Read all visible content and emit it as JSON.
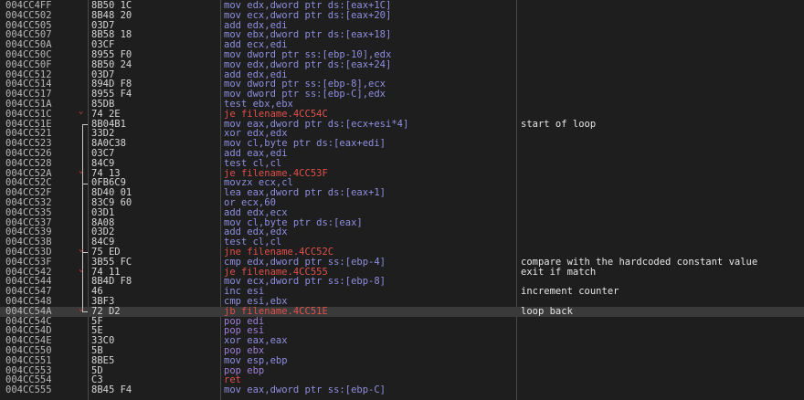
{
  "colors": {
    "background": "#1e1e1e",
    "address": "#b8b8b8",
    "bytes": "#d6d6d6",
    "instruction": "#8f8fe0",
    "jump_instruction": "#e0504a",
    "comment": "#e6e6e6",
    "selected_row": "#3a3a3a"
  },
  "rows": [
    {
      "addr": "004CC4FF",
      "bytes": "8B50 1C",
      "instr": "mov edx,dword ptr ds:[eax+1C]",
      "kind": "mov",
      "comment": ""
    },
    {
      "addr": "004CC502",
      "bytes": "8B48 20",
      "instr": "mov ecx,dword ptr ds:[eax+20]",
      "kind": "mov",
      "comment": ""
    },
    {
      "addr": "004CC505",
      "bytes": "03D7",
      "instr": "add edx,edi",
      "kind": "mov",
      "comment": ""
    },
    {
      "addr": "004CC507",
      "bytes": "8B58 18",
      "instr": "mov ebx,dword ptr ds:[eax+18]",
      "kind": "mov",
      "comment": ""
    },
    {
      "addr": "004CC50A",
      "bytes": "03CF",
      "instr": "add ecx,edi",
      "kind": "mov",
      "comment": ""
    },
    {
      "addr": "004CC50C",
      "bytes": "8955 F0",
      "instr": "mov dword ptr ss:[ebp-10],edx",
      "kind": "mov",
      "comment": ""
    },
    {
      "addr": "004CC50F",
      "bytes": "8B50 24",
      "instr": "mov edx,dword ptr ds:[eax+24]",
      "kind": "mov",
      "comment": ""
    },
    {
      "addr": "004CC512",
      "bytes": "03D7",
      "instr": "add edx,edi",
      "kind": "mov",
      "comment": ""
    },
    {
      "addr": "004CC514",
      "bytes": "894D F8",
      "instr": "mov dword ptr ss:[ebp-8],ecx",
      "kind": "mov",
      "comment": ""
    },
    {
      "addr": "004CC517",
      "bytes": "8955 F4",
      "instr": "mov dword ptr ss:[ebp-C],edx",
      "kind": "mov",
      "comment": ""
    },
    {
      "addr": "004CC51A",
      "bytes": "85DB",
      "instr": "test ebx,ebx",
      "kind": "mov",
      "comment": ""
    },
    {
      "addr": "004CC51C",
      "bytes": "74 2E",
      "instr": "je filename.4CC54C",
      "kind": "jump",
      "comment": ""
    },
    {
      "addr": "004CC51E",
      "bytes": "8B04B1",
      "instr": "mov eax,dword ptr ds:[ecx+esi*4]",
      "kind": "mov",
      "comment": "start of loop"
    },
    {
      "addr": "004CC521",
      "bytes": "33D2",
      "instr": "xor edx,edx",
      "kind": "mov",
      "comment": ""
    },
    {
      "addr": "004CC523",
      "bytes": "8A0C38",
      "instr": "mov cl,byte ptr ds:[eax+edi]",
      "kind": "mov",
      "comment": ""
    },
    {
      "addr": "004CC526",
      "bytes": "03C7",
      "instr": "add eax,edi",
      "kind": "mov",
      "comment": ""
    },
    {
      "addr": "004CC528",
      "bytes": "84C9",
      "instr": "test cl,cl",
      "kind": "mov",
      "comment": ""
    },
    {
      "addr": "004CC52A",
      "bytes": "74 13",
      "instr": "je filename.4CC53F",
      "kind": "jump",
      "comment": ""
    },
    {
      "addr": "004CC52C",
      "bytes": "0FB6C9",
      "instr": "movzx ecx,cl",
      "kind": "mov",
      "comment": ""
    },
    {
      "addr": "004CC52F",
      "bytes": "8D40 01",
      "instr": "lea eax,dword ptr ds:[eax+1]",
      "kind": "mov",
      "comment": ""
    },
    {
      "addr": "004CC532",
      "bytes": "83C9 60",
      "instr": "or ecx,60",
      "kind": "mov",
      "comment": ""
    },
    {
      "addr": "004CC535",
      "bytes": "03D1",
      "instr": "add edx,ecx",
      "kind": "mov",
      "comment": ""
    },
    {
      "addr": "004CC537",
      "bytes": "8A08",
      "instr": "mov cl,byte ptr ds:[eax]",
      "kind": "mov",
      "comment": ""
    },
    {
      "addr": "004CC539",
      "bytes": "03D2",
      "instr": "add edx,edx",
      "kind": "mov",
      "comment": ""
    },
    {
      "addr": "004CC53B",
      "bytes": "84C9",
      "instr": "test cl,cl",
      "kind": "mov",
      "comment": ""
    },
    {
      "addr": "004CC53D",
      "bytes": "75 ED",
      "instr": "jne filename.4CC52C",
      "kind": "jump",
      "comment": ""
    },
    {
      "addr": "004CC53F",
      "bytes": "3B55 FC",
      "instr": "cmp edx,dword ptr ss:[ebp-4]",
      "kind": "mov",
      "comment": "compare with the hardcoded constant value"
    },
    {
      "addr": "004CC542",
      "bytes": "74 11",
      "instr": "je filename.4CC555",
      "kind": "jump",
      "comment": "exit if match"
    },
    {
      "addr": "004CC544",
      "bytes": "8B4D F8",
      "instr": "mov ecx,dword ptr ss:[ebp-8]",
      "kind": "mov",
      "comment": ""
    },
    {
      "addr": "004CC547",
      "bytes": "46",
      "instr": "inc esi",
      "kind": "mov",
      "comment": "increment counter"
    },
    {
      "addr": "004CC548",
      "bytes": "3BF3",
      "instr": "cmp esi,ebx",
      "kind": "mov",
      "comment": ""
    },
    {
      "addr": "004CC54A",
      "bytes": "72 D2",
      "instr": "jb filename.4CC51E",
      "kind": "jump",
      "comment": "loop back"
    },
    {
      "addr": "004CC54C",
      "bytes": "5F",
      "instr": "pop edi",
      "kind": "pp",
      "comment": ""
    },
    {
      "addr": "004CC54D",
      "bytes": "5E",
      "instr": "pop esi",
      "kind": "pp",
      "comment": ""
    },
    {
      "addr": "004CC54E",
      "bytes": "33C0",
      "instr": "xor eax,eax",
      "kind": "mov",
      "comment": ""
    },
    {
      "addr": "004CC550",
      "bytes": "5B",
      "instr": "pop ebx",
      "kind": "pp",
      "comment": ""
    },
    {
      "addr": "004CC551",
      "bytes": "8BE5",
      "instr": "mov esp,ebp",
      "kind": "mov",
      "comment": ""
    },
    {
      "addr": "004CC553",
      "bytes": "5D",
      "instr": "pop ebp",
      "kind": "pp",
      "comment": ""
    },
    {
      "addr": "004CC554",
      "bytes": "C3",
      "instr": "ret",
      "kind": "ret",
      "comment": ""
    },
    {
      "addr": "004CC555",
      "bytes": "8B45 F4",
      "instr": "mov eax,dword ptr ss:[ebp-C]",
      "kind": "mov",
      "comment": ""
    }
  ],
  "selected_index": 31,
  "jumps": [
    {
      "from": 31,
      "to": 12
    },
    {
      "from": 25,
      "to": 18
    }
  ]
}
